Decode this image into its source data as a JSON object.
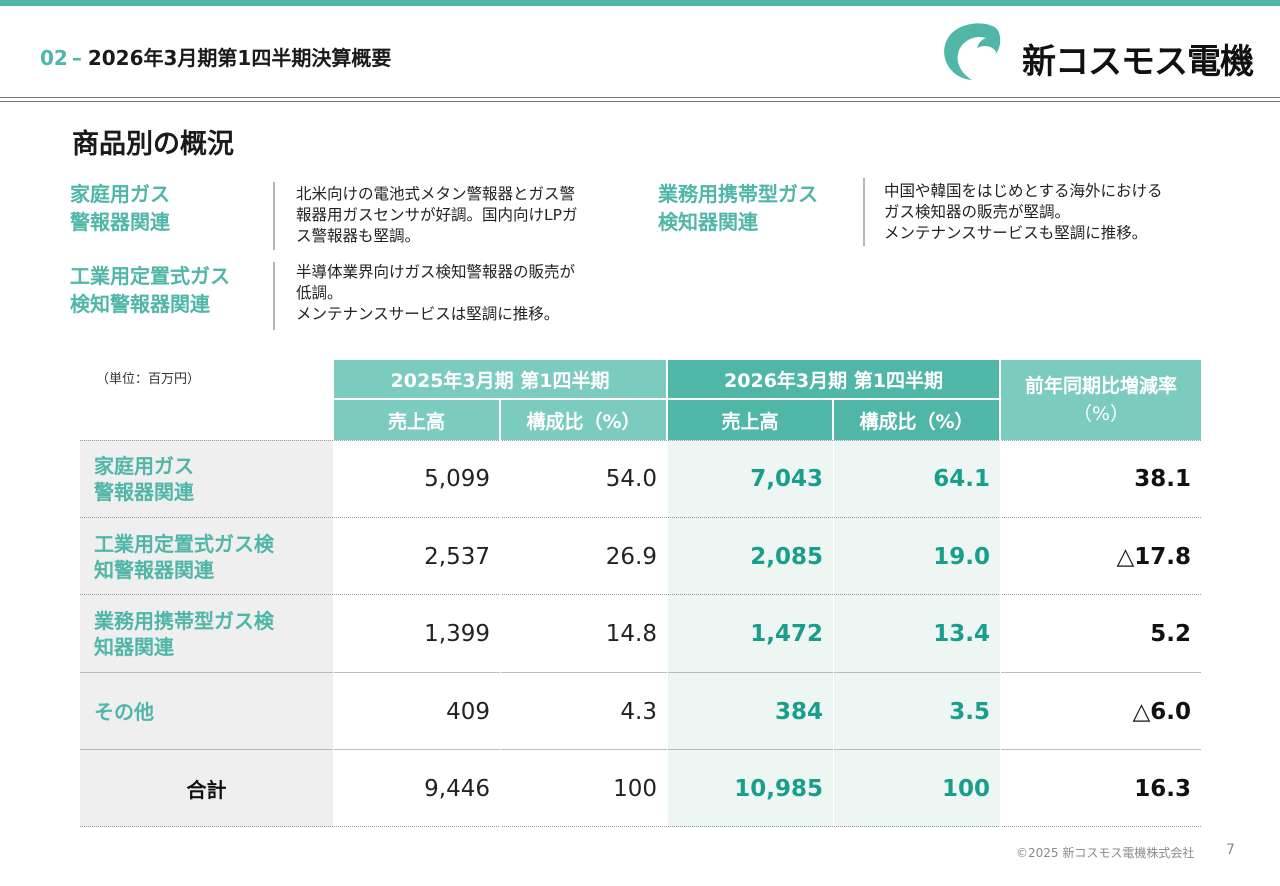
{
  "header": {
    "section_num": "02",
    "dash": "–",
    "title": "2026年3月期第1四半期決算概要"
  },
  "logo": {
    "text": "新コスモス電機",
    "icon": "cosmos-logo-icon",
    "color": "#4fb6a8"
  },
  "section_title": "商品別の概況",
  "categories": [
    {
      "name_l1": "家庭用ガス",
      "name_l2": "警報器関連",
      "desc_l1": "北米向けの電池式メタン警報器とガス警",
      "desc_l2": "報器用ガスセンサが好調。国内向けLPガ",
      "desc_l3": "ス警報器も堅調。"
    },
    {
      "name_l1": "工業用定置式ガス",
      "name_l2": "検知警報器関連",
      "desc_l1": "半導体業界向けガス検知警報器の販売が",
      "desc_l2": "低調。",
      "desc_l3": "メンテナンスサービスは堅調に推移。"
    },
    {
      "name_l1": "業務用携帯型ガス",
      "name_l2": "検知器関連",
      "desc_l1": "中国や韓国をはじめとする海外における",
      "desc_l2": "ガス検知器の販売が堅調。",
      "desc_l3": "メンテナンスサービスも堅調に推移。"
    }
  ],
  "table": {
    "unit_note": "（単位：百万円）",
    "period_prev": "2025年3月期 第1四半期",
    "period_curr": "2026年3月期 第1四半期",
    "change_l1": "前年同期比増減率",
    "change_l2": "（%）",
    "col_sales": "売上高",
    "col_ratio": "構成比（%）",
    "rows": [
      {
        "label_l1": "家庭用ガス",
        "label_l2": "警報器関連",
        "prev_sales": "5,099",
        "prev_ratio": "54.0",
        "curr_sales": "7,043",
        "curr_ratio": "64.1",
        "change": "38.1"
      },
      {
        "label_l1": "工業用定置式ガス検",
        "label_l2": "知警報器関連",
        "prev_sales": "2,537",
        "prev_ratio": "26.9",
        "curr_sales": "2,085",
        "curr_ratio": "19.0",
        "change": "△17.8"
      },
      {
        "label_l1": "業務用携帯型ガス検",
        "label_l2": "知器関連",
        "prev_sales": "1,399",
        "prev_ratio": "14.8",
        "curr_sales": "1,472",
        "curr_ratio": "13.4",
        "change": "5.2"
      },
      {
        "label_l1": "その他",
        "label_l2": "",
        "prev_sales": "409",
        "prev_ratio": "4.3",
        "curr_sales": "384",
        "curr_ratio": "3.5",
        "change": "△6.0"
      }
    ],
    "total": {
      "label": "合計",
      "prev_sales": "9,446",
      "prev_ratio": "100",
      "curr_sales": "10,985",
      "curr_ratio": "100",
      "change": "16.3"
    }
  },
  "footer": {
    "copyright": "©2025 新コスモス電機株式会社",
    "page": "7"
  }
}
